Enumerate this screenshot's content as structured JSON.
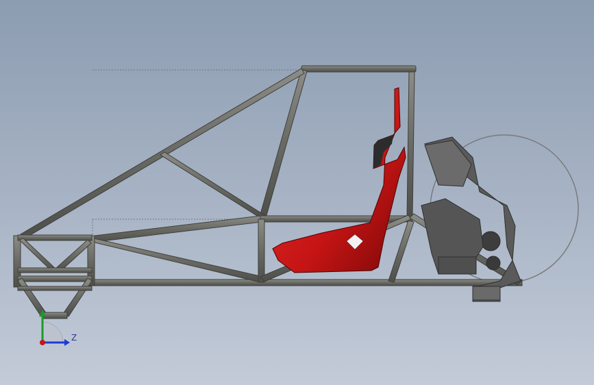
{
  "viewport": {
    "background_top": "#8c9cb1",
    "background_bottom": "#c3cbd8"
  },
  "model": {
    "frame_color": "#6b6b66",
    "frame_highlight": "#8a8a84",
    "seat_color": "#d11a1a",
    "seat_shadow": "#8e0e0e",
    "engine_color": "#5a5a5a",
    "wheel_outline": "#7a7a7a"
  },
  "triad": {
    "z_label": "Z",
    "z_color": "#1f3bd6",
    "y_color": "#1a9a2a",
    "origin_color": "#c4161c",
    "x_icon": "view-orientation-triad-icon"
  }
}
